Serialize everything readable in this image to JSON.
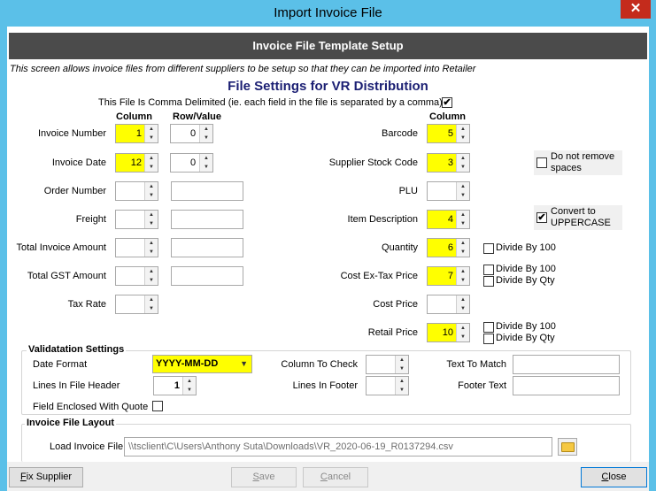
{
  "window": {
    "title": "Import Invoice File",
    "close_glyph": "✕"
  },
  "header": {
    "title": "Invoice File Template Setup"
  },
  "intro": "This screen allows invoice files from different suppliers to be setup so that they can be imported into Retailer",
  "settings_title": "File Settings for VR Distribution",
  "comma_delimited": {
    "label": "This File Is Comma Delimited (ie. each field in the file is separated by a comma)",
    "checked": "✔"
  },
  "left_headers": {
    "column": "Column",
    "row_value": "Row/Value"
  },
  "right_header": "Column",
  "left_fields": {
    "invoice_number": {
      "label": "Invoice Number",
      "column": "1",
      "row": "0"
    },
    "invoice_date": {
      "label": "Invoice Date",
      "column": "12",
      "row": "0"
    },
    "order_number": {
      "label": "Order Number",
      "column": "",
      "value": ""
    },
    "freight": {
      "label": "Freight",
      "column": "",
      "value": ""
    },
    "total_invoice_amount": {
      "label": "Total Invoice Amount",
      "column": "",
      "value": ""
    },
    "total_gst_amount": {
      "label": "Total GST Amount",
      "column": "",
      "value": ""
    },
    "tax_rate": {
      "label": "Tax Rate",
      "column": ""
    }
  },
  "right_fields": {
    "barcode": {
      "label": "Barcode",
      "column": "5"
    },
    "supplier_stock_code": {
      "label": "Supplier Stock Code",
      "column": "3"
    },
    "plu": {
      "label": "PLU",
      "column": ""
    },
    "item_description": {
      "label": "Item Description",
      "column": "4"
    },
    "quantity": {
      "label": "Quantity",
      "column": "6"
    },
    "cost_ex_tax_price": {
      "label": "Cost Ex-Tax Price",
      "column": "7"
    },
    "cost_price": {
      "label": "Cost Price",
      "column": ""
    },
    "retail_price": {
      "label": "Retail Price",
      "column": "10"
    }
  },
  "options": {
    "do_not_remove_spaces": "Do not remove spaces",
    "convert_uppercase": "Convert to UPPERCASE",
    "convert_checked": "✔",
    "divide_by_100": "Divide By 100",
    "divide_by_qty": "Divide By Qty"
  },
  "validation": {
    "title": "Validatation Settings",
    "date_format_label": "Date Format",
    "date_format_value": "YYYY-MM-DD",
    "lines_header_label": "Lines In File Header",
    "lines_header_value": "1",
    "field_enclosed_label": "Field Enclosed With Quote",
    "column_to_check_label": "Column To Check",
    "column_to_check_value": "",
    "lines_footer_label": "Lines In Footer",
    "lines_footer_value": "",
    "text_to_match_label": "Text To Match",
    "text_to_match_value": "",
    "footer_text_label": "Footer Text",
    "footer_text_value": ""
  },
  "layout": {
    "title": "Invoice File Layout",
    "load_label": "Load Invoice File",
    "file_path": "\\\\tsclient\\C\\Users\\Anthony Suta\\Downloads\\VR_2020-06-19_R0137294.csv"
  },
  "buttons": {
    "fix_supplier": {
      "ul": "F",
      "rest": "ix Supplier"
    },
    "save": {
      "ul": "S",
      "rest": "ave"
    },
    "cancel": {
      "ul": "C",
      "rest": "ancel"
    },
    "close": {
      "ul": "C",
      "rest": "lose"
    }
  },
  "icons": {
    "spin_up": "▲",
    "spin_down": "▼",
    "dropdown": "▼",
    "folder": "folder-icon"
  },
  "colors": {
    "required_field": "#ffff00",
    "header_bar": "#4b4b4b",
    "title_text": "#1b1f73",
    "titlebar": "#5bc0e8"
  }
}
